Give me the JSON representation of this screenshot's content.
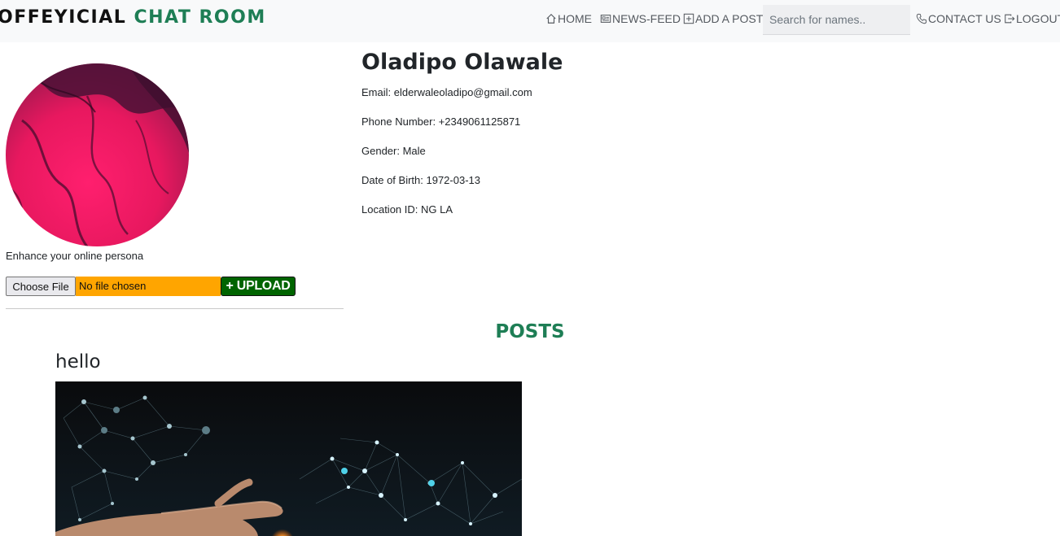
{
  "brand": {
    "part1": "OFFEYICIAL",
    "part2": "CHAT ROOM"
  },
  "nav": {
    "home": "HOME",
    "news_feed": "NEWS-FEED",
    "add_post": "ADD A POST",
    "search_placeholder": "Search for names..",
    "contact": "CONTACT US",
    "logout": "LOGOUT"
  },
  "profile": {
    "name": "Oladipo Olawale",
    "email": "Email: elderwaleoladipo@gmail.com",
    "phone": "Phone Number: +2349061125871",
    "gender": "Gender: Male",
    "dob": "Date of Birth: 1972-03-13",
    "location": "Location ID: NG LA",
    "tagline": "Enhance your online persona"
  },
  "upload": {
    "choose_label": "Choose File",
    "file_status": "No file chosen",
    "upload_label": "+ UPLOAD"
  },
  "posts": {
    "heading": "POSTS",
    "items": [
      {
        "title": "hello"
      }
    ]
  },
  "colors": {
    "brand_green": "#1e7e55",
    "upload_green": "#006400",
    "file_status_bg": "#ffa500"
  }
}
